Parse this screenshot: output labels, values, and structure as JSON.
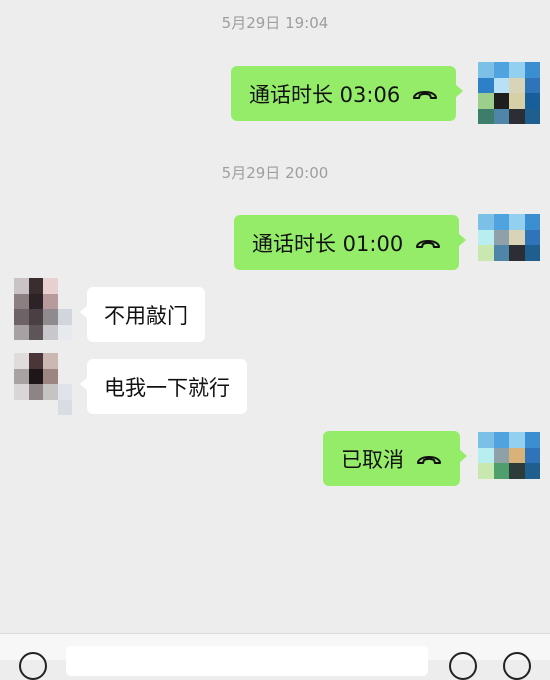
{
  "messages": [
    {
      "type": "timestamp",
      "text": "5月29日 19:04"
    },
    {
      "type": "call",
      "direction": "out",
      "text": "通话时长 03:06",
      "icon": "phone-hangup-icon"
    },
    {
      "type": "timestamp",
      "text": "5月29日 20:00"
    },
    {
      "type": "call",
      "direction": "out",
      "text": "通话时长 01:00",
      "icon": "phone-hangup-icon"
    },
    {
      "type": "text",
      "direction": "in",
      "text": "不用敲门"
    },
    {
      "type": "text",
      "direction": "in",
      "text": "电我一下就行"
    },
    {
      "type": "call",
      "direction": "out",
      "text": "已取消",
      "icon": "phone-hangup-icon"
    }
  ],
  "colors": {
    "background": "#ededed",
    "outgoing_bubble": "#95ec69",
    "incoming_bubble": "#ffffff",
    "timestamp_text": "#9e9e9e"
  },
  "input_bar": {
    "voice_icon": "voice-icon",
    "emoji_icon": "emoji-icon",
    "more_icon": "plus-icon"
  }
}
